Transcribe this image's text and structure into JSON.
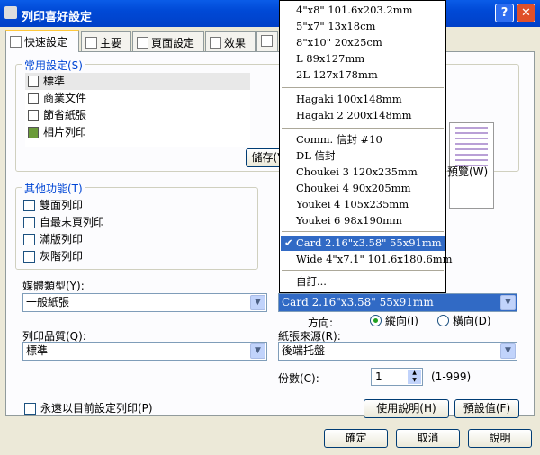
{
  "window": {
    "title": "列印喜好設定",
    "help_btn": "?",
    "close_btn": "✕"
  },
  "tabs": [
    {
      "label": "快速設定"
    },
    {
      "label": "主要"
    },
    {
      "label": "頁面設定"
    },
    {
      "label": "效果"
    }
  ],
  "common": {
    "group_label": "常用設定(S)",
    "items": [
      {
        "label": "標準"
      },
      {
        "label": "商業文件"
      },
      {
        "label": "節省紙張"
      },
      {
        "label": "相片列印"
      }
    ],
    "save_button": "儲存(V",
    "preview_label": "預覽(W)"
  },
  "other": {
    "group_label": "其他功能(T)",
    "options": [
      {
        "label": "雙面列印"
      },
      {
        "label": "自最末頁列印"
      },
      {
        "label": "滿版列印"
      },
      {
        "label": "灰階列印"
      }
    ]
  },
  "media": {
    "label": "媒體類型(Y):",
    "value": "一般紙張"
  },
  "quality": {
    "label": "列印品質(Q):",
    "value": "標準"
  },
  "paper_size": {
    "value": "Card 2.16\"x3.58\" 55x91mm"
  },
  "orientation": {
    "label": "方向:",
    "portrait": "縱向(I)",
    "landscape": "橫向(D)"
  },
  "source": {
    "label": "紙張來源(R):",
    "value": "後端托盤"
  },
  "copies": {
    "label": "份數(C):",
    "value": "1",
    "range": "(1-999)"
  },
  "always_print": "永遠以目前設定列印(P)",
  "help_button": "使用說明(H)",
  "defaults_button": "預設值(F)",
  "footer": {
    "ok": "確定",
    "cancel": "取消",
    "help": "說明"
  },
  "dropdown": {
    "items": [
      {
        "label": "4\"x8\" 101.6x203.2mm"
      },
      {
        "label": "5\"x7\" 13x18cm"
      },
      {
        "label": "8\"x10\" 20x25cm"
      },
      {
        "label": "L 89x127mm"
      },
      {
        "label": "2L 127x178mm"
      },
      {
        "label": "Hagaki 100x148mm"
      },
      {
        "label": "Hagaki 2 200x148mm"
      },
      {
        "label": "Comm. 信封 #10"
      },
      {
        "label": "DL 信封"
      },
      {
        "label": "Choukei 3 120x235mm"
      },
      {
        "label": "Choukei 4 90x205mm"
      },
      {
        "label": "Youkei 4 105x235mm"
      },
      {
        "label": "Youkei 6 98x190mm"
      },
      {
        "label": "Card 2.16\"x3.58\" 55x91mm",
        "selected": true
      },
      {
        "label": "Wide 4\"x7.1\" 101.6x180.6mm"
      },
      {
        "label": "自訂..."
      }
    ]
  }
}
